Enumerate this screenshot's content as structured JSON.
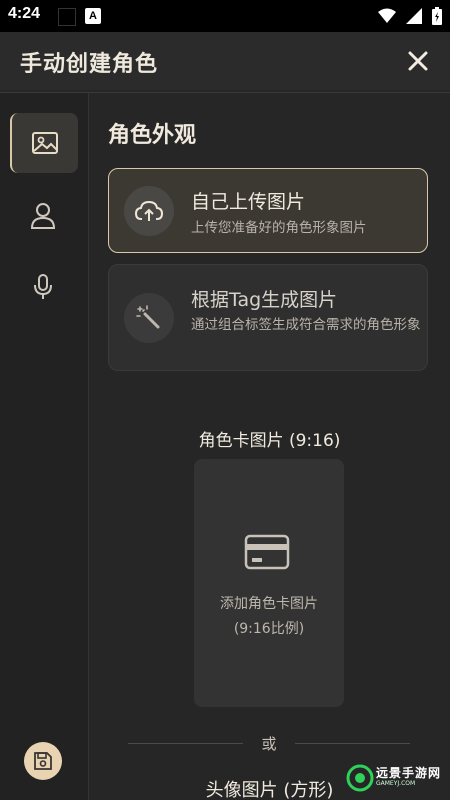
{
  "status_bar": {
    "time": "4:24",
    "app_badge": "A"
  },
  "header": {
    "title": "手动创建角色"
  },
  "sidebar": {
    "items": [
      {
        "icon": "image-icon",
        "active": true
      },
      {
        "icon": "person-icon",
        "active": false
      },
      {
        "icon": "microphone-icon",
        "active": false
      }
    ],
    "save_icon": "save-icon"
  },
  "main": {
    "section_title": "角色外观",
    "options": [
      {
        "title": "自己上传图片",
        "description": "上传您准备好的角色形象图片",
        "icon": "cloud-upload-icon",
        "selected": true
      },
      {
        "title": "根据Tag生成图片",
        "description": "通过组合标签生成符合需求的角色形象",
        "icon": "magic-wand-icon",
        "selected": false
      }
    ],
    "card_label": "角色卡图片 (9:16)",
    "card_upload": {
      "line1": "添加角色卡图片",
      "line2": "(9:16比例)",
      "icon": "card-icon"
    },
    "or_text": "或",
    "avatar_label": "头像图片 (方形)"
  },
  "watermark": {
    "text": "远景手游网",
    "sub": "GAMEYJ.COM"
  },
  "colors": {
    "accent": "#d9c9a9",
    "background": "#262626",
    "save_button": "#e8d4b2"
  }
}
